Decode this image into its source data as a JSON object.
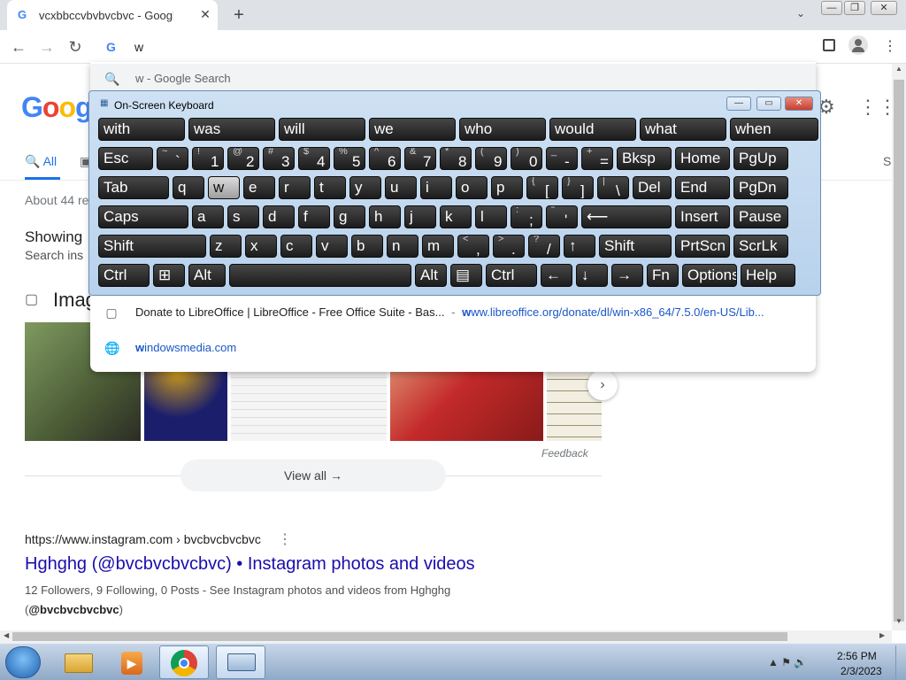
{
  "browser": {
    "tab_title": "vcxbbccvbvbvcbvc - Google Search",
    "tab_favicon": "G",
    "tab_close": "✕",
    "new_tab": "+",
    "tab_search": "⌄",
    "window_buttons": {
      "minimize": "—",
      "maximize": "❐",
      "close": "✕"
    },
    "nav": {
      "back": "←",
      "forward": "→",
      "reload": "↻"
    },
    "omnibox_value": "w",
    "omnibox_icon": "G",
    "toolbar_icons": [
      "side-panel-icon",
      "profile-icon",
      "menu-icon"
    ]
  },
  "dropdown": {
    "items": [
      {
        "type": "search",
        "icon": "🔍",
        "text": "w - Google Search"
      },
      {
        "type": "history",
        "icon": "▢",
        "text": "Donate to LibreOffice | LibreOffice - Free Office Suite - Bas...",
        "sep": "-",
        "url_bold": "w",
        "url_rest": "ww.libreoffice.org/donate/dl/win-x86_64/7.5.0/en-US/Lib..."
      },
      {
        "type": "site",
        "icon": "🌐",
        "url_bold": "w",
        "url_rest": "indowsmedia.com"
      }
    ]
  },
  "osk": {
    "title": "On-Screen Keyboard",
    "buttons": {
      "minimize": "—",
      "restore": "▭",
      "close": "✕"
    },
    "rows": [
      [
        {
          "l": "with",
          "w": 98
        },
        {
          "l": "was",
          "w": 98
        },
        {
          "l": "will",
          "w": 98
        },
        {
          "l": "we",
          "w": 98
        },
        {
          "l": "who",
          "w": 98
        },
        {
          "l": "would",
          "w": 98
        },
        {
          "l": "what",
          "w": 98
        },
        {
          "l": "when",
          "w": 100
        }
      ],
      [
        {
          "l": "Esc",
          "w": 62
        },
        {
          "t": "~",
          "b": "`",
          "w": 36
        },
        {
          "t": "!",
          "b": "1",
          "w": 36
        },
        {
          "t": "@",
          "b": "2",
          "w": 36
        },
        {
          "t": "#",
          "b": "3",
          "w": 36
        },
        {
          "t": "$",
          "b": "4",
          "w": 36
        },
        {
          "t": "%",
          "b": "5",
          "w": 36
        },
        {
          "t": "^",
          "b": "6",
          "w": 36
        },
        {
          "t": "&",
          "b": "7",
          "w": 36
        },
        {
          "t": "*",
          "b": "8",
          "w": 36
        },
        {
          "t": "(",
          "b": "9",
          "w": 36
        },
        {
          "t": ")",
          "b": "0",
          "w": 36
        },
        {
          "t": "_",
          "b": "-",
          "w": 36
        },
        {
          "t": "+",
          "b": "=",
          "w": 36
        },
        {
          "l": "Bksp",
          "w": 62
        },
        {
          "l": "Home",
          "w": 62
        },
        {
          "l": "PgUp",
          "w": 62
        }
      ],
      [
        {
          "l": "Tab",
          "w": 80
        },
        {
          "l": "q",
          "w": 36
        },
        {
          "l": "w",
          "w": 36,
          "p": true
        },
        {
          "l": "e",
          "w": 36
        },
        {
          "l": "r",
          "w": 36
        },
        {
          "l": "t",
          "w": 36
        },
        {
          "l": "y",
          "w": 36
        },
        {
          "l": "u",
          "w": 36
        },
        {
          "l": "i",
          "w": 36
        },
        {
          "l": "o",
          "w": 36
        },
        {
          "l": "p",
          "w": 36
        },
        {
          "t": "{",
          "b": "[",
          "w": 36
        },
        {
          "t": "}",
          "b": "]",
          "w": 36
        },
        {
          "t": "|",
          "b": "\\",
          "w": 36
        },
        {
          "l": "Del",
          "w": 44
        },
        {
          "l": "End",
          "w": 62
        },
        {
          "l": "PgDn",
          "w": 62
        }
      ],
      [
        {
          "l": "Caps",
          "w": 102
        },
        {
          "l": "a",
          "w": 36
        },
        {
          "l": "s",
          "w": 36
        },
        {
          "l": "d",
          "w": 36
        },
        {
          "l": "f",
          "w": 36
        },
        {
          "l": "g",
          "w": 36
        },
        {
          "l": "h",
          "w": 36
        },
        {
          "l": "j",
          "w": 36
        },
        {
          "l": "k",
          "w": 36
        },
        {
          "l": "l",
          "w": 36
        },
        {
          "t": ":",
          "b": ";",
          "w": 36
        },
        {
          "t": "\"",
          "b": "'",
          "w": 36
        },
        {
          "l": "⟵",
          "w": 102
        },
        {
          "l": "Insert",
          "w": 62
        },
        {
          "l": "Pause",
          "w": 62
        }
      ],
      [
        {
          "l": "Shift",
          "w": 122
        },
        {
          "l": "z",
          "w": 36
        },
        {
          "l": "x",
          "w": 36
        },
        {
          "l": "c",
          "w": 36
        },
        {
          "l": "v",
          "w": 36
        },
        {
          "l": "b",
          "w": 36
        },
        {
          "l": "n",
          "w": 36
        },
        {
          "l": "m",
          "w": 36
        },
        {
          "t": "<",
          "b": ",",
          "w": 36
        },
        {
          "t": ">",
          "b": ".",
          "w": 36
        },
        {
          "t": "?",
          "b": "/",
          "w": 36
        },
        {
          "l": "↑",
          "w": 36
        },
        {
          "l": "Shift",
          "w": 82
        },
        {
          "l": "PrtScn",
          "w": 62
        },
        {
          "l": "ScrLk",
          "w": 62
        }
      ],
      [
        {
          "l": "Ctrl",
          "w": 58
        },
        {
          "l": "⊞",
          "w": 36
        },
        {
          "l": "Alt",
          "w": 42
        },
        {
          "l": "",
          "w": 206
        },
        {
          "l": "Alt",
          "w": 36
        },
        {
          "l": "▤",
          "w": 36
        },
        {
          "l": "Ctrl",
          "w": 58
        },
        {
          "l": "←",
          "w": 36
        },
        {
          "l": "↓",
          "w": 36
        },
        {
          "l": "→",
          "w": 36
        },
        {
          "l": "Fn",
          "w": 36
        },
        {
          "l": "Options",
          "w": 62
        },
        {
          "l": "Help",
          "w": 62
        }
      ]
    ]
  },
  "page": {
    "logo": "Google",
    "tab_all": "All",
    "tab_s": "S",
    "about": "About 44 re",
    "showing": "Showing",
    "search_ins": "Search ins",
    "images_heading": "Imag",
    "feedback": "Feedback",
    "view_all": "View all",
    "view_all_arrow": "→",
    "result": {
      "url": "https://www.instagram.com › bvcbvcbvcbvc",
      "menu": "⋮",
      "title": "Hghghg (@bvcbvcbvcbvc) • Instagram photos and videos",
      "snippet_1": "12 Followers, 9 Following, 0 Posts - See Instagram photos and videos from Hghghg",
      "snippet_2_open": "(",
      "snippet_2_bold": "@bvcbvcbvcbvc",
      "snippet_2_close": ")"
    },
    "thumb_colors": [
      "#5f7a4a",
      "#1b1f6b",
      "#f0f0f0",
      "#c32a2a",
      "#f2eee2"
    ]
  },
  "taskbar": {
    "time": "2:56 PM",
    "date": "2/3/2023",
    "apps": [
      "explorer-icon",
      "media-player-icon",
      "chrome-icon",
      "osk-icon"
    ],
    "tray": "▲  ⚑  🔊"
  }
}
